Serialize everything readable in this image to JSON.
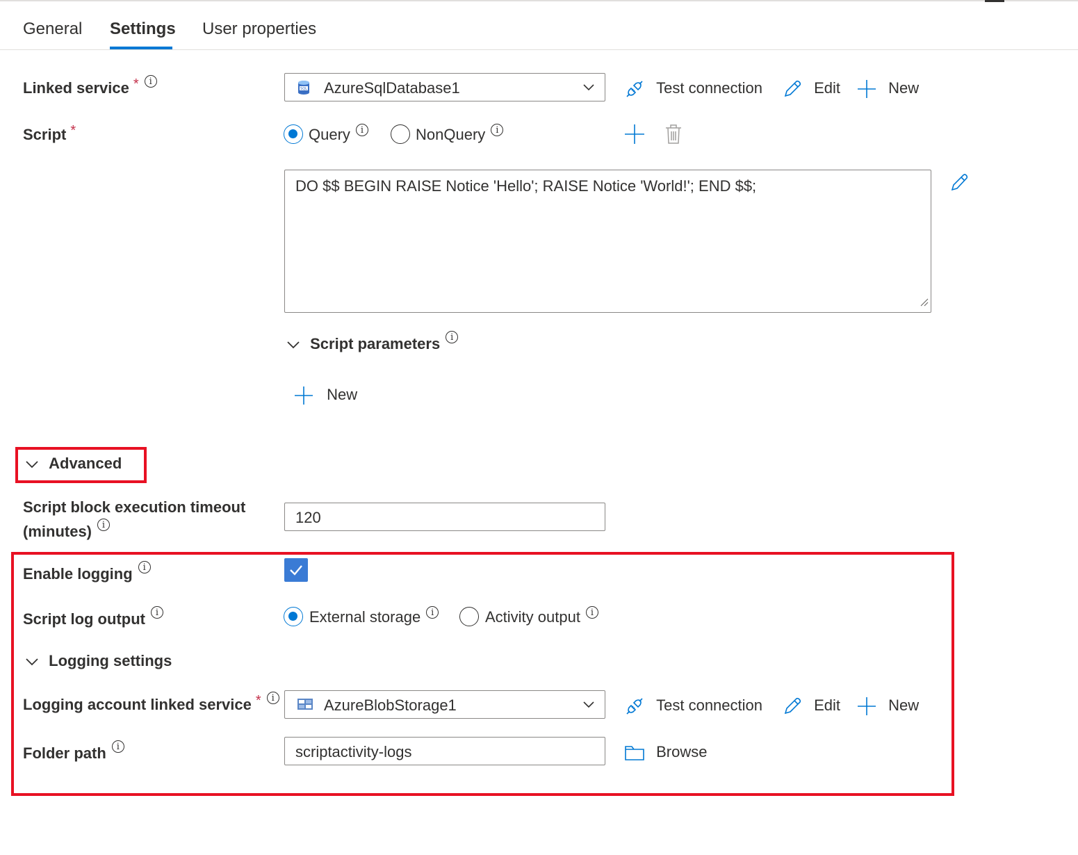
{
  "tabs": [
    {
      "label": "General"
    },
    {
      "label": "Settings",
      "active": true
    },
    {
      "label": "User properties"
    }
  ],
  "linked_service": {
    "label": "Linked service",
    "required_mark": "*",
    "value": "AzureSqlDatabase1",
    "icon": "sql-database-icon"
  },
  "actions": {
    "test_connection": "Test connection",
    "edit": "Edit",
    "new": "New",
    "browse": "Browse"
  },
  "script": {
    "label": "Script",
    "required_mark": "*",
    "type_options": [
      {
        "label": "Query",
        "checked": true
      },
      {
        "label": "NonQuery",
        "checked": false
      }
    ],
    "text": "DO $$ BEGIN RAISE Notice 'Hello'; RAISE Notice 'World!'; END $$;"
  },
  "script_parameters": {
    "header": "Script parameters",
    "new_label": "New"
  },
  "advanced": {
    "header": "Advanced",
    "timeout_label_line1": "Script block execution timeout",
    "timeout_label_line2": "(minutes)",
    "timeout_value": "120",
    "enable_logging_label": "Enable logging",
    "enable_logging_checked": true,
    "log_output_label": "Script log output",
    "log_output_options": [
      {
        "label": "External storage",
        "checked": true
      },
      {
        "label": "Activity output",
        "checked": false
      }
    ],
    "logging_settings_header": "Logging settings",
    "logging_account_label": "Logging account linked service",
    "logging_account_required_mark": "*",
    "logging_account_value": "AzureBlobStorage1",
    "logging_account_icon": "blob-storage-icon",
    "folder_path_label": "Folder path",
    "folder_path_value": "scriptactivity-logs"
  },
  "colors": {
    "accent": "#0078d4",
    "highlight_box": "#e81123",
    "required": "#c4314b",
    "checkbox": "#3a7bd5"
  }
}
